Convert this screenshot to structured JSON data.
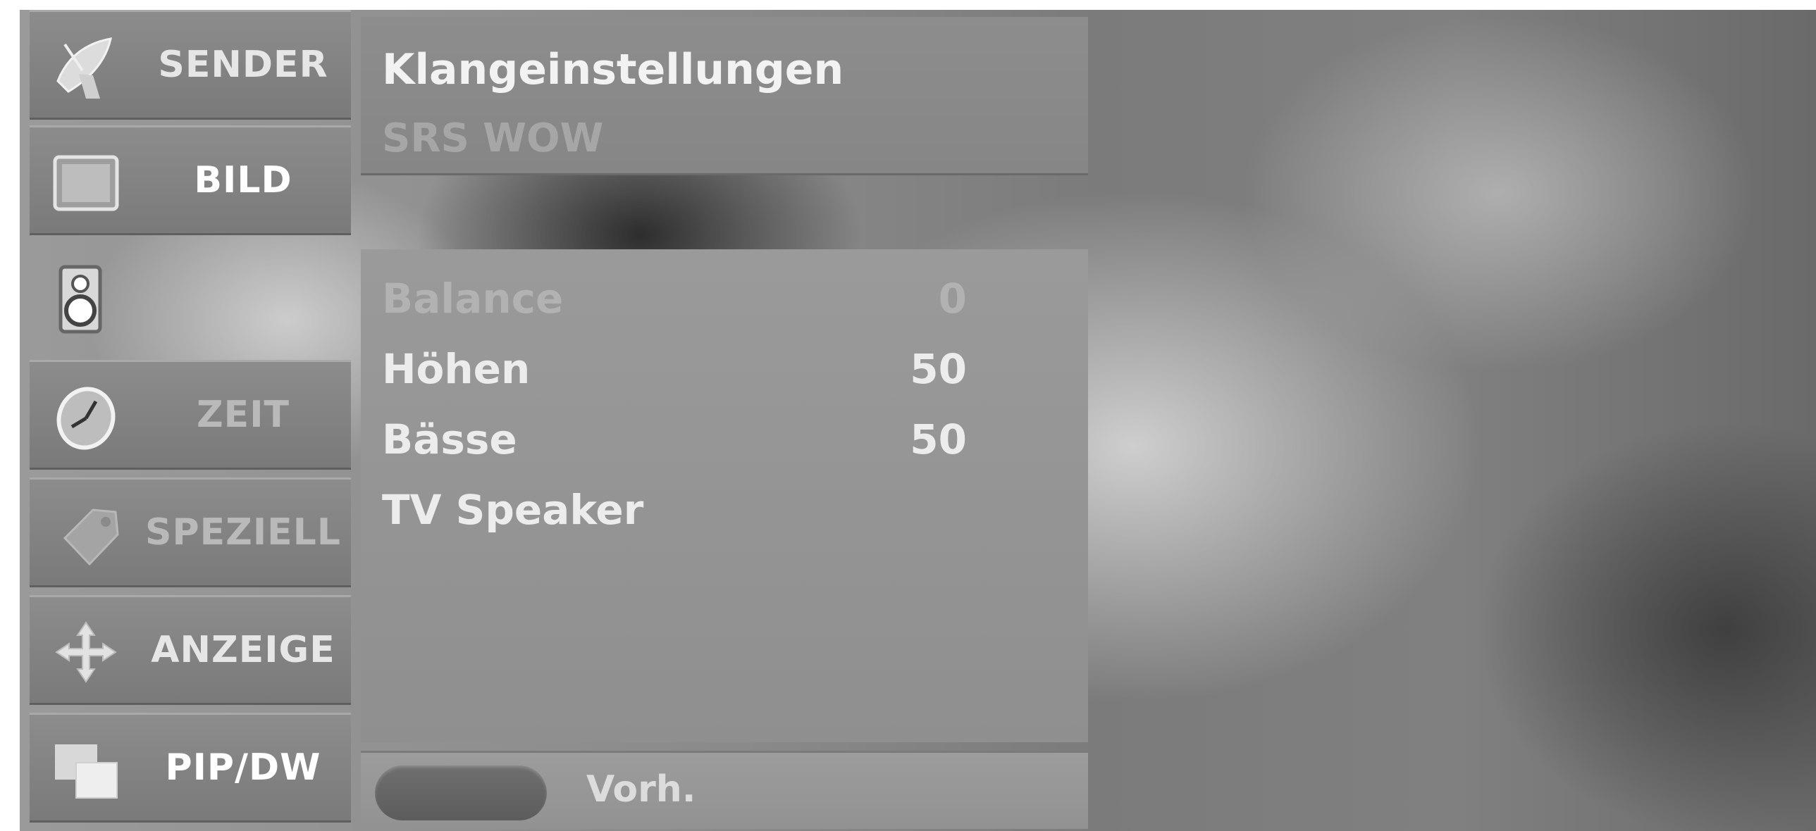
{
  "sidebar": {
    "items": [
      {
        "label": "SENDER",
        "icon": "satellite-dish-icon"
      },
      {
        "label": "BILD",
        "icon": "tv-screen-icon"
      },
      {
        "label": "",
        "icon": "speaker-icon"
      },
      {
        "label": "ZEIT",
        "icon": "clock-icon"
      },
      {
        "label": "SPEZIELL",
        "icon": "tag-icon"
      },
      {
        "label": "ANZEIGE",
        "icon": "move-arrows-icon"
      },
      {
        "label": "PIP/DW",
        "icon": "pip-windows-icon"
      }
    ]
  },
  "panel": {
    "title": "Klangeinstellungen",
    "subtitle": "SRS WOW"
  },
  "settings": [
    {
      "label": "Balance",
      "value": "0"
    },
    {
      "label": "Höhen",
      "value": "50"
    },
    {
      "label": "Bässe",
      "value": "50"
    },
    {
      "label": "TV Speaker",
      "value": ""
    }
  ],
  "footer": {
    "label": "Vorh."
  }
}
